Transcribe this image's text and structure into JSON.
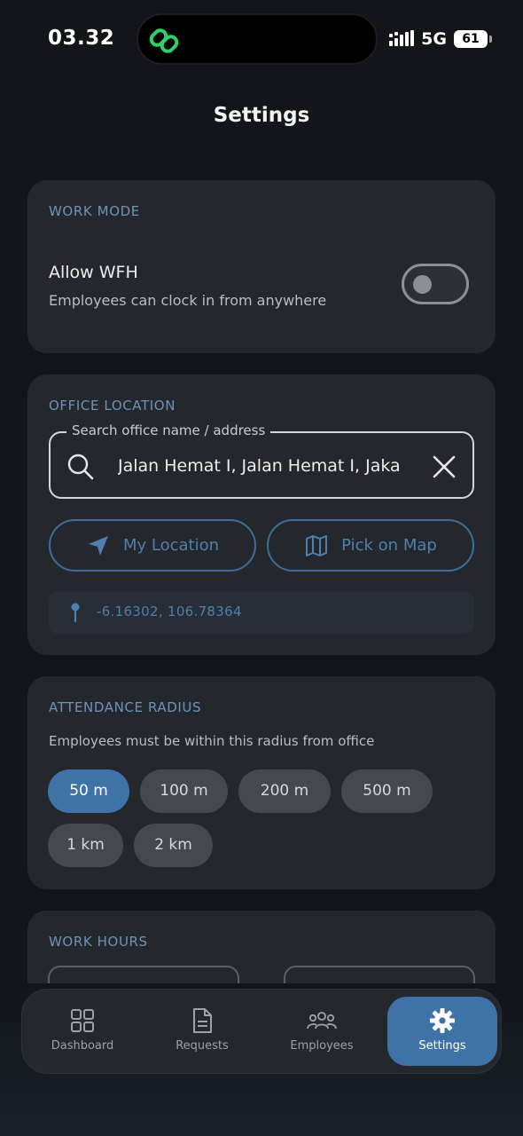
{
  "status_bar": {
    "time": "03.32",
    "network": "5G",
    "battery": "61"
  },
  "header": {
    "title": "Settings"
  },
  "work_mode": {
    "section_title": "WORK MODE",
    "allow_wfh_title": "Allow WFH",
    "allow_wfh_desc": "Employees can clock in from anywhere",
    "allow_wfh_enabled": false
  },
  "office_location": {
    "section_title": "OFFICE LOCATION",
    "search_label": "Search office name / address",
    "search_value": "Jalan Hemat I, Jalan Hemat I, Jaka",
    "my_location_label": "My Location",
    "pick_on_map_label": "Pick on Map",
    "coordinates": "-6.16302, 106.78364"
  },
  "attendance_radius": {
    "section_title": "ATTENDANCE RADIUS",
    "description": "Employees must be within this radius from office",
    "options": [
      "50 m",
      "100 m",
      "200 m",
      "500 m",
      "1 km",
      "2 km"
    ],
    "selected": "50 m"
  },
  "work_hours": {
    "section_title": "WORK HOURS"
  },
  "bottom_nav": {
    "items": [
      {
        "label": "Dashboard",
        "icon": "grid-icon"
      },
      {
        "label": "Requests",
        "icon": "document-icon"
      },
      {
        "label": "Employees",
        "icon": "users-icon"
      },
      {
        "label": "Settings",
        "icon": "gear-icon"
      }
    ],
    "active": "Settings"
  },
  "colors": {
    "background": "#12161b",
    "card": "#24282d",
    "accent": "#3f72a6",
    "section_title": "#6f93b8",
    "app_icon": "#2fd06b"
  }
}
